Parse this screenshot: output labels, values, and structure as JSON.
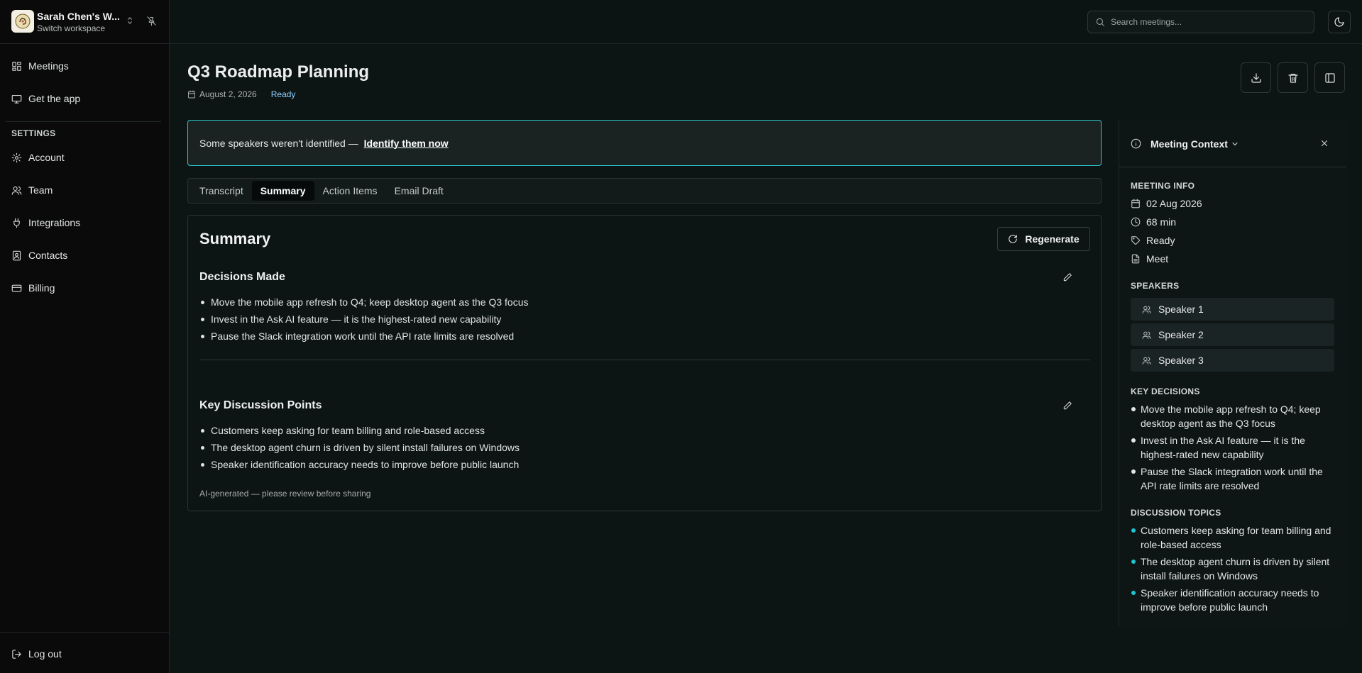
{
  "workspace": {
    "name": "Sarah Chen's W...",
    "subtitle": "Switch workspace"
  },
  "nav": {
    "items": [
      {
        "label": "Meetings",
        "icon": "dashboard-icon"
      },
      {
        "label": "Get the app",
        "icon": "monitor-icon"
      }
    ],
    "settings_heading": "SETTINGS",
    "settings": [
      {
        "label": "Account",
        "icon": "gear-icon"
      },
      {
        "label": "Team",
        "icon": "users-icon"
      },
      {
        "label": "Integrations",
        "icon": "plug-icon"
      },
      {
        "label": "Contacts",
        "icon": "contact-book-icon"
      },
      {
        "label": "Billing",
        "icon": "credit-card-icon"
      }
    ],
    "logout": "Log out"
  },
  "search": {
    "placeholder": "Search meetings..."
  },
  "meeting": {
    "title": "Q3 Roadmap Planning",
    "date": "August 2, 2026",
    "status": "Ready"
  },
  "banner": {
    "text": "Some speakers weren't identified —",
    "link": "Identify them now"
  },
  "tabs": [
    "Transcript",
    "Summary",
    "Action Items",
    "Email Draft"
  ],
  "active_tab": "Summary",
  "summary": {
    "title": "Summary",
    "regenerate_label": "Regenerate",
    "decisions_title": "Decisions Made",
    "decisions": [
      "Move the mobile app refresh to Q4; keep desktop agent as the Q3 focus",
      "Invest in the Ask AI feature — it is the highest-rated new capability",
      "Pause the Slack integration work until the API rate limits are resolved"
    ],
    "discussion_title": "Key Discussion Points",
    "discussion": [
      "Customers keep asking for team billing and role-based access",
      "The desktop agent churn is driven by silent install failures on Windows",
      "Speaker identification accuracy needs to improve before public launch"
    ],
    "disclaimer": "AI-generated — please review before sharing"
  },
  "context": {
    "title": "Meeting Context",
    "meeting_info_heading": "MEETING INFO",
    "info": {
      "date": "02 Aug 2026",
      "duration": "68 min",
      "status": "Ready",
      "platform": "Meet"
    },
    "speakers_heading": "SPEAKERS",
    "speakers": [
      "Speaker 1",
      "Speaker 2",
      "Speaker 3"
    ],
    "decisions_heading": "KEY DECISIONS",
    "decisions": [
      "Move the mobile app refresh to Q4; keep desktop agent as the Q3 focus",
      "Invest in the Ask AI feature — it is the highest-rated new capability",
      "Pause the Slack integration work until the API rate limits are resolved"
    ],
    "topics_heading": "DISCUSSION TOPICS",
    "topics": [
      "Customers keep asking for team billing and role-based access",
      "The desktop agent churn is driven by silent install failures on Windows",
      "Speaker identification accuracy needs to improve before public launch"
    ]
  },
  "colors": {
    "accent": "#2cc9cf",
    "status_ready": "#8fd3ff",
    "topic_bullet": "#22c3d0",
    "background": "#0d1414"
  }
}
